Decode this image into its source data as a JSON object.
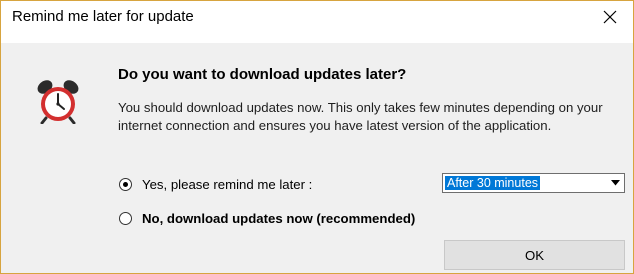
{
  "window": {
    "title": "Remind me later for update",
    "close_symbol": "✕"
  },
  "icons": {
    "main": "alarm-clock-icon",
    "close": "close-icon",
    "dropdown": "chevron-down-icon"
  },
  "content": {
    "heading": "Do you want to download updates later?",
    "message": "You should download updates now. This only takes few minutes depending on your internet connection and ensures you have latest version of the application."
  },
  "options": {
    "remind_label": "Yes, please remind me later :",
    "remind_selected": true,
    "download_now_label": "No, download updates now (recommended)",
    "download_now_selected": false
  },
  "delay_select": {
    "value": "After 30 minutes"
  },
  "buttons": {
    "ok_label": "OK"
  },
  "colors": {
    "border": "#d7a43f",
    "client_bg": "#f0f0f0",
    "selection": "#0078d7",
    "clock_red": "#d32f2f"
  }
}
